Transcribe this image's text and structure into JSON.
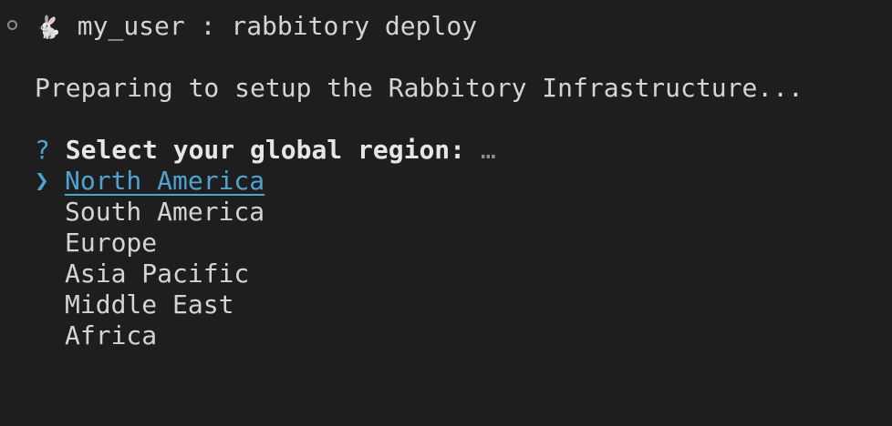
{
  "prompt": {
    "icon": "rabbit-icon",
    "icon_glyph": "🐇",
    "user": "my_user",
    "separator": ":",
    "command": "rabbitory deploy"
  },
  "message": "Preparing to setup the Rabbitory Infrastructure...",
  "question": {
    "marker": "?",
    "text": "Select your global region:",
    "ellipsis": "…"
  },
  "pointer": "❯",
  "options": [
    {
      "label": "North America",
      "selected": true
    },
    {
      "label": "South America",
      "selected": false
    },
    {
      "label": "Europe",
      "selected": false
    },
    {
      "label": "Asia Pacific",
      "selected": false
    },
    {
      "label": "Middle East",
      "selected": false
    },
    {
      "label": "Africa",
      "selected": false
    }
  ],
  "colors": {
    "background": "#1e1e1e",
    "text": "#d4d4d4",
    "accent": "#4fa3d1"
  }
}
